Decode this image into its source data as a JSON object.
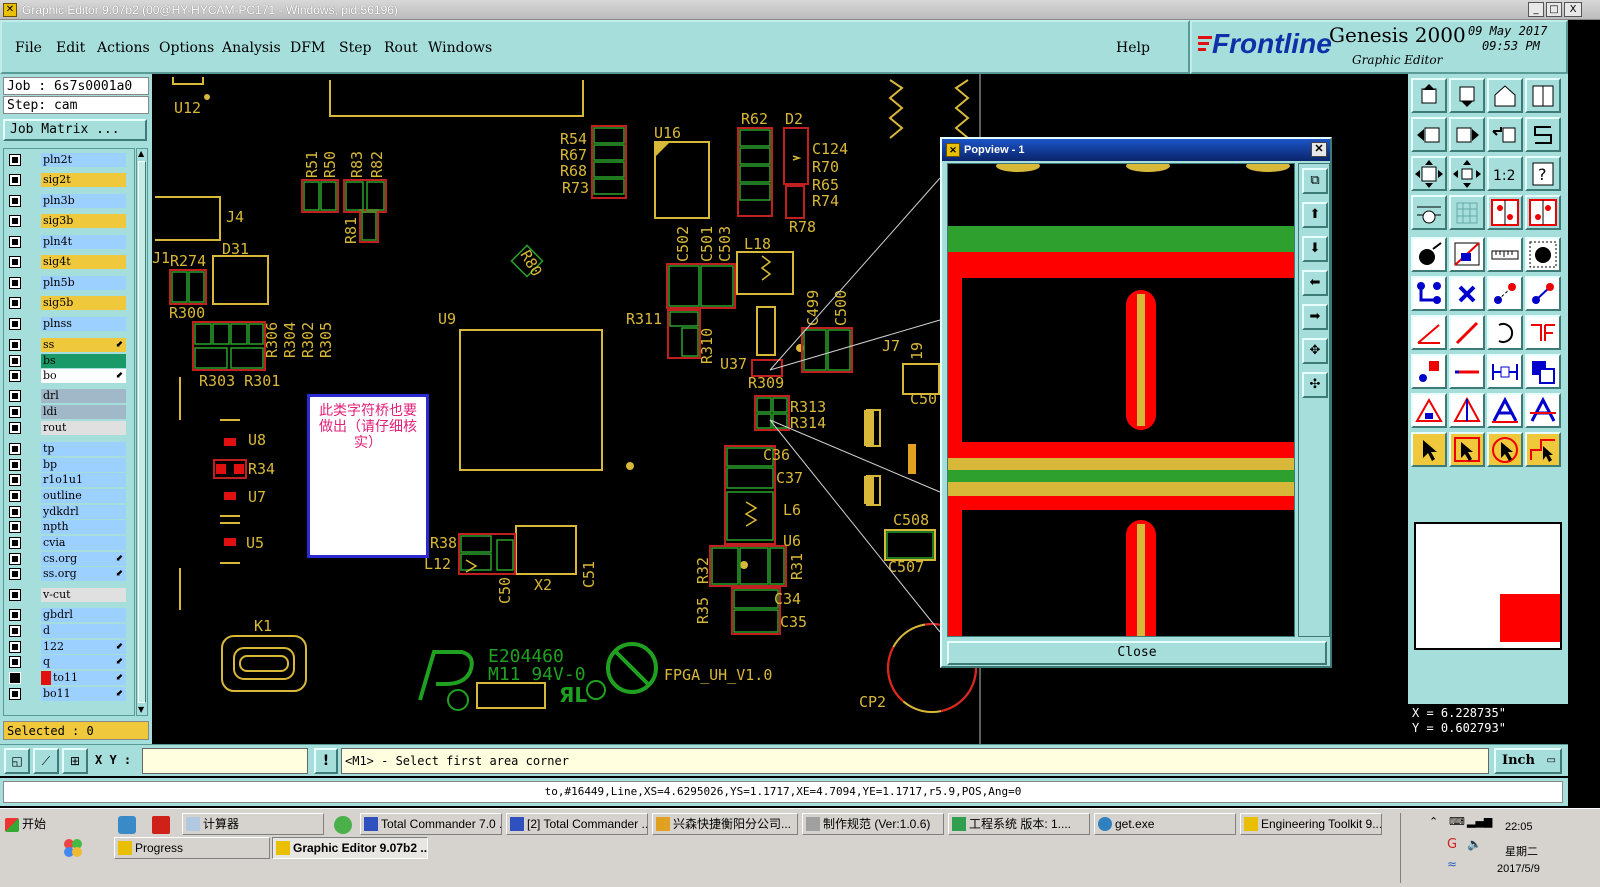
{
  "window": {
    "title": "Graphic Editor 9.07b2 (00@HY-HYCAM-PC171 - Windows, pid:56196)",
    "controls": [
      "_",
      "□",
      "X"
    ]
  },
  "menu": {
    "items": [
      "File",
      "Edit",
      "Actions",
      "Options",
      "Analysis",
      "DFM",
      "Step",
      "Rout",
      "Windows"
    ],
    "help": "Help"
  },
  "brand": {
    "logo": "Frontline",
    "product": "Genesis 2000",
    "subtitle": "Graphic Editor",
    "date": "09 May 2017",
    "time": "09:53 PM"
  },
  "job": {
    "job_line": "Job : 6s7s0001a0",
    "step_line": "Step: cam",
    "matrix_button": "Job Matrix ..."
  },
  "layers": [
    {
      "name": "pln2t",
      "color": "#9cd0ff"
    },
    {
      "name": "sig2t",
      "color": "#f0c83c"
    },
    {
      "name": "pln3b",
      "color": "#9cd0ff"
    },
    {
      "name": "sig3b",
      "color": "#f0c83c"
    },
    {
      "name": "pln4t",
      "color": "#9cd0ff"
    },
    {
      "name": "sig4t",
      "color": "#f0c83c"
    },
    {
      "name": "pln5b",
      "color": "#9cd0ff"
    },
    {
      "name": "sig5b",
      "color": "#f0c83c"
    },
    {
      "name": "plnss",
      "color": "#9cd0ff"
    },
    {
      "name": "ss",
      "color": "#f0c83c"
    },
    {
      "name": "bs",
      "color": "#1a9a68"
    },
    {
      "name": "bo",
      "color": "#ffffff"
    },
    {
      "name": "drl",
      "color": "#a0b8c8"
    },
    {
      "name": "ldi",
      "color": "#a0b8c8"
    },
    {
      "name": "rout",
      "color": "#e0e0e0"
    },
    {
      "name": "tp",
      "color": "#9cd0ff"
    },
    {
      "name": "bp",
      "color": "#9cd0ff"
    },
    {
      "name": "r1o1u1",
      "color": "#9cd0ff"
    },
    {
      "name": "outline",
      "color": "#9cd0ff"
    },
    {
      "name": "ydkdrl",
      "color": "#9cd0ff"
    },
    {
      "name": "npth",
      "color": "#9cd0ff"
    },
    {
      "name": "cvia",
      "color": "#9cd0ff"
    },
    {
      "name": "cs.org",
      "color": "#9cd0ff"
    },
    {
      "name": "ss.org",
      "color": "#9cd0ff"
    },
    {
      "name": "v-cut",
      "color": "#e0e0e0"
    },
    {
      "name": "gbdrl",
      "color": "#9cd0ff"
    },
    {
      "name": "d",
      "color": "#9cd0ff"
    },
    {
      "name": "122",
      "color": "#9cd0ff"
    },
    {
      "name": "q",
      "color": "#9cd0ff"
    },
    {
      "name": "to11",
      "color": "#9cd0ff"
    },
    {
      "name": "bo11",
      "color": "#9cd0ff"
    }
  ],
  "selected": "Selected : 0",
  "popview": {
    "title": "Popview - 1",
    "close_label": "Close"
  },
  "note": {
    "text": "此类字符桥也要做出（请仔细核实）"
  },
  "coords": {
    "x": "X = 6.228735\"",
    "y": "Y = 0.602793\""
  },
  "command": {
    "xy_label": "X Y :",
    "xy_value": "",
    "prompt": "<M1> - Select first area corner",
    "units": "Inch"
  },
  "status": {
    "text": "to,#16449,Line,XS=4.6295026,YS=1.1717,XE=4.7094,YE=1.1717,r5.9,POS,Ang=0"
  },
  "board_labels": {
    "marking": "E204460",
    "marking2": "M11 94V-0",
    "board_name": "FPGA_UH_V1.0"
  },
  "ref_designators": [
    "U12",
    "R51",
    "R50",
    "R83",
    "R82",
    "R81",
    "J4",
    "D31",
    "R274",
    "R300",
    "R306",
    "R304",
    "R302",
    "R305",
    "R303",
    "R301",
    "U9",
    "R54",
    "R67",
    "R68",
    "R73",
    "U16",
    "C502",
    "C501",
    "C503",
    "L18",
    "R62",
    "D2",
    "C124",
    "R70",
    "R65",
    "R74",
    "R78",
    "R311",
    "R310",
    "C499",
    "C500",
    "U37",
    "R309",
    "R313",
    "R314",
    "J7",
    "C50",
    "U8",
    "R34",
    "U7",
    "U5",
    "R38",
    "L12",
    "C50",
    "X2",
    "C51",
    "C36",
    "C37",
    "L6",
    "U6",
    "R32",
    "R31",
    "R35",
    "C34",
    "C35",
    "C508",
    "C507",
    "K1",
    "CP2",
    "R80"
  ],
  "taskbar": {
    "start": "开始",
    "tasks": [
      "计算器",
      "Total Commander 7.0 ...",
      "[2] Total Commander ...",
      "兴森快捷衡阳分公司...",
      "制作规范 (Ver:1.0.6)",
      "工程系统  版本: 1....",
      "get.exe",
      "Engineering Toolkit 9....",
      "Progress",
      "Graphic Editor 9.07b2 ..."
    ],
    "clock_time": "22:05",
    "clock_day": "星期二",
    "clock_date": "2017/5/9"
  }
}
